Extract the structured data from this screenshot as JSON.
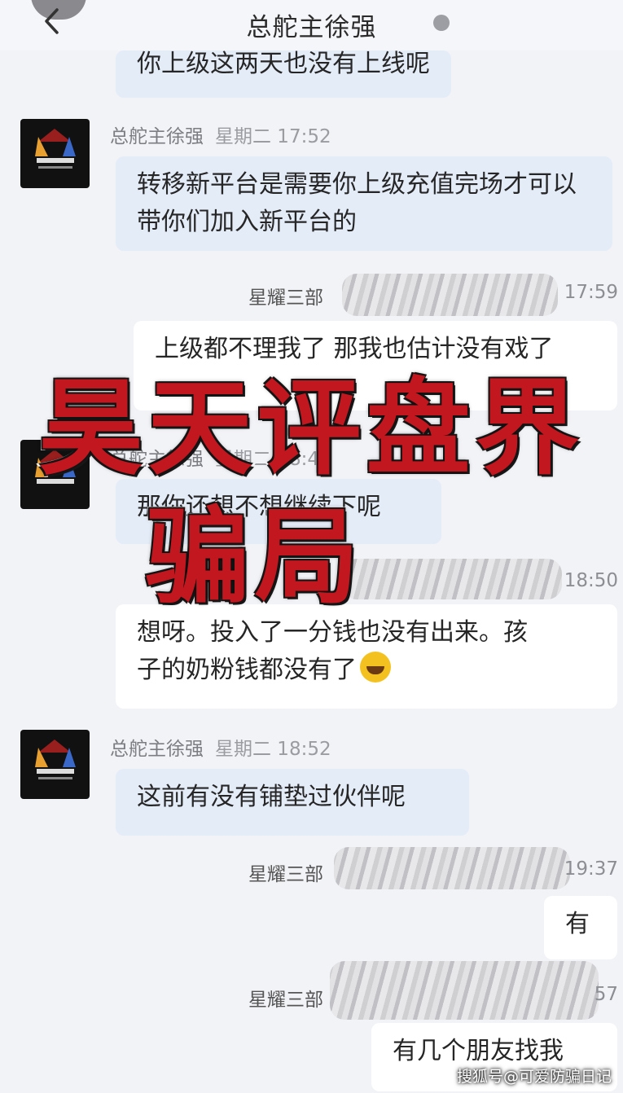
{
  "header": {
    "title": "总舵主徐强"
  },
  "messages": {
    "m0": {
      "text": "你上级这两天也没有上线呢"
    },
    "m1": {
      "sender": "总舵主徐强",
      "time": "星期二 17:52",
      "text": "转移新平台是需要你上级充值完场才可以带你们加入新平台的"
    },
    "m2": {
      "sender": "星耀三部",
      "time": "17:59",
      "text": "上级都不理我了 那我也估计没有戏了"
    },
    "m3": {
      "sender": "总舵主徐强",
      "time": "星期二 18:4",
      "text": "那你还想不想继续下呢"
    },
    "m4": {
      "time": "18:50",
      "line1": "想呀。投入了一分钱也没有出来。孩",
      "line2": "子的奶粉钱都没有了"
    },
    "m5": {
      "sender": "总舵主徐强",
      "time": "星期二 18:52",
      "text": "这前有没有铺垫过伙伴呢"
    },
    "m6": {
      "sender": "星耀三部",
      "time": "19:37",
      "text": "有"
    },
    "m7": {
      "sender": "星耀三部",
      "time": "57",
      "text": "有几个朋友找我"
    }
  },
  "overlay": {
    "line1": "昊天评盘界",
    "line2": "骗局"
  },
  "watermark": "搜狐号@可爱防骗日记",
  "colors": {
    "incoming_bubble": "#e4ecf8",
    "outgoing_bubble": "#ffffff",
    "overlay_text": "#c3171f",
    "background": "#f2f3f7"
  },
  "icons": {
    "back": "chevron-left-icon",
    "status": "status-dot-icon",
    "emoji": "laughing-emoji-icon"
  }
}
